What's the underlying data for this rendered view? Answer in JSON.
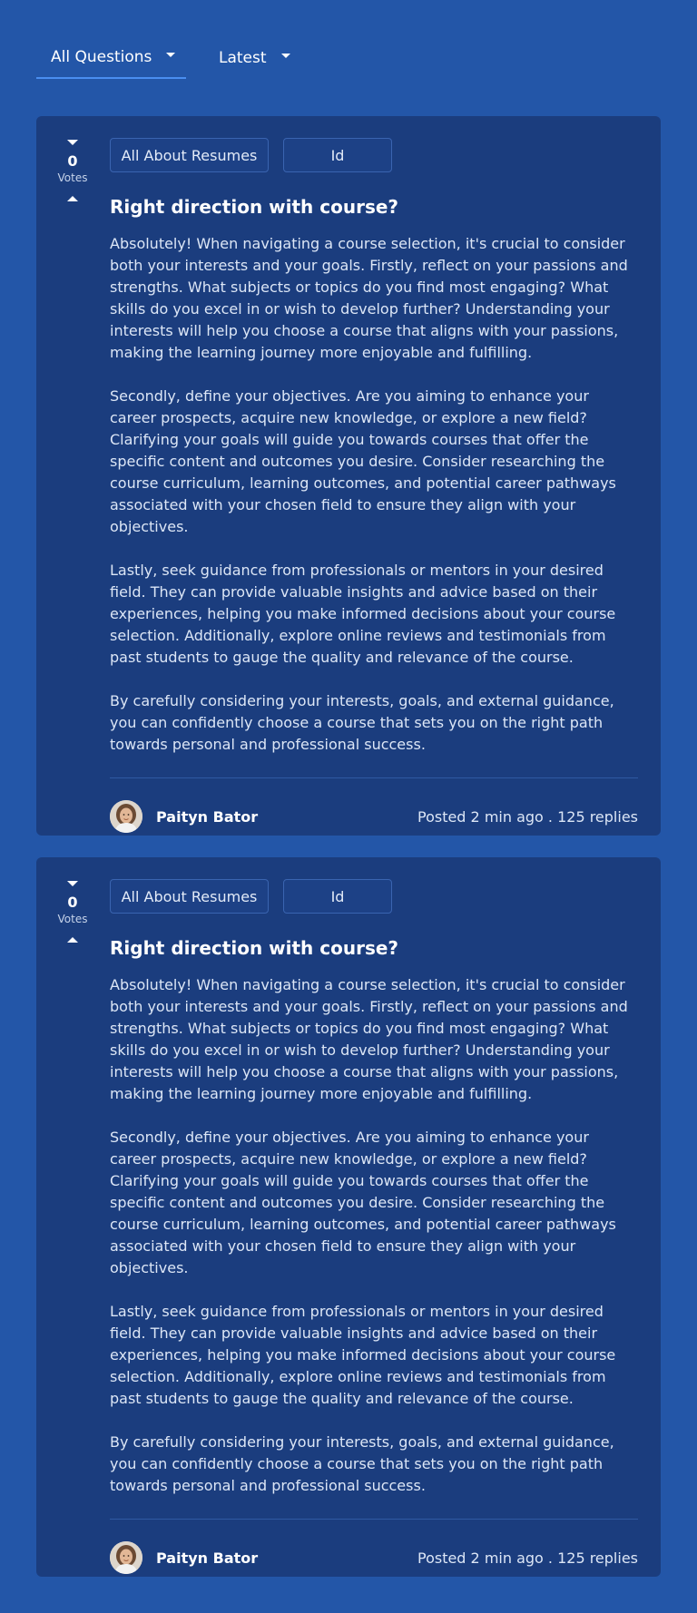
{
  "filters": {
    "category": "All Questions",
    "sort": "Latest"
  },
  "posts": [
    {
      "votes": "0",
      "votes_label": "Votes",
      "tags": [
        "All About Resumes",
        "Id"
      ],
      "title": "Right direction with course?",
      "paragraphs": [
        "Absolutely! When navigating a course selection, it's crucial to consider both your interests and your goals. Firstly, reflect on your passions and strengths. What subjects or topics do you find most engaging? What skills do you excel in or wish to develop further? Understanding your interests will help you choose a course that aligns with your passions, making the learning journey more enjoyable and fulfilling.",
        "Secondly, define your objectives. Are you aiming to enhance your career prospects, acquire new knowledge, or explore a new field? Clarifying your goals will guide you towards courses that offer the specific content and outcomes you desire. Consider researching the course curriculum, learning outcomes, and potential career pathways associated with your chosen field to ensure they align with your objectives.",
        "Lastly, seek guidance from professionals or mentors in your desired field. They can provide valuable insights and advice based on their experiences, helping you make informed decisions about your course selection. Additionally, explore online reviews and testimonials from past students to gauge the quality and relevance of the course.",
        "By carefully considering your interests, goals, and external guidance, you can confidently choose a course that sets you on the right path towards personal and professional success."
      ],
      "author": "Paityn Bator",
      "meta": "Posted 2 min ago . 125 replies"
    },
    {
      "votes": "0",
      "votes_label": "Votes",
      "tags": [
        "All About Resumes",
        "Id"
      ],
      "title": "Right direction with course?",
      "paragraphs": [
        "Absolutely! When navigating a course selection, it's crucial to consider both your interests and your goals. Firstly, reflect on your passions and strengths. What subjects or topics do you find most engaging? What skills do you excel in or wish to develop further? Understanding your interests will help you choose a course that aligns with your passions, making the learning journey more enjoyable and fulfilling.",
        "Secondly, define your objectives. Are you aiming to enhance your career prospects, acquire new knowledge, or explore a new field? Clarifying your goals will guide you towards courses that offer the specific content and outcomes you desire. Consider researching the course curriculum, learning outcomes, and potential career pathways associated with your chosen field to ensure they align with your objectives.",
        "Lastly, seek guidance from professionals or mentors in your desired field. They can provide valuable insights and advice based on their experiences, helping you make informed decisions about your course selection. Additionally, explore online reviews and testimonials from past students to gauge the quality and relevance of the course.",
        "By carefully considering your interests, goals, and external guidance, you can confidently choose a course that sets you on the right path towards personal and professional success."
      ],
      "author": "Paityn Bator",
      "meta": "Posted 2 min ago . 125 replies"
    }
  ],
  "icons": {
    "downvote": "chevron-down-icon",
    "upvote": "chevron-up-icon",
    "dropdown": "caret-down-icon"
  }
}
